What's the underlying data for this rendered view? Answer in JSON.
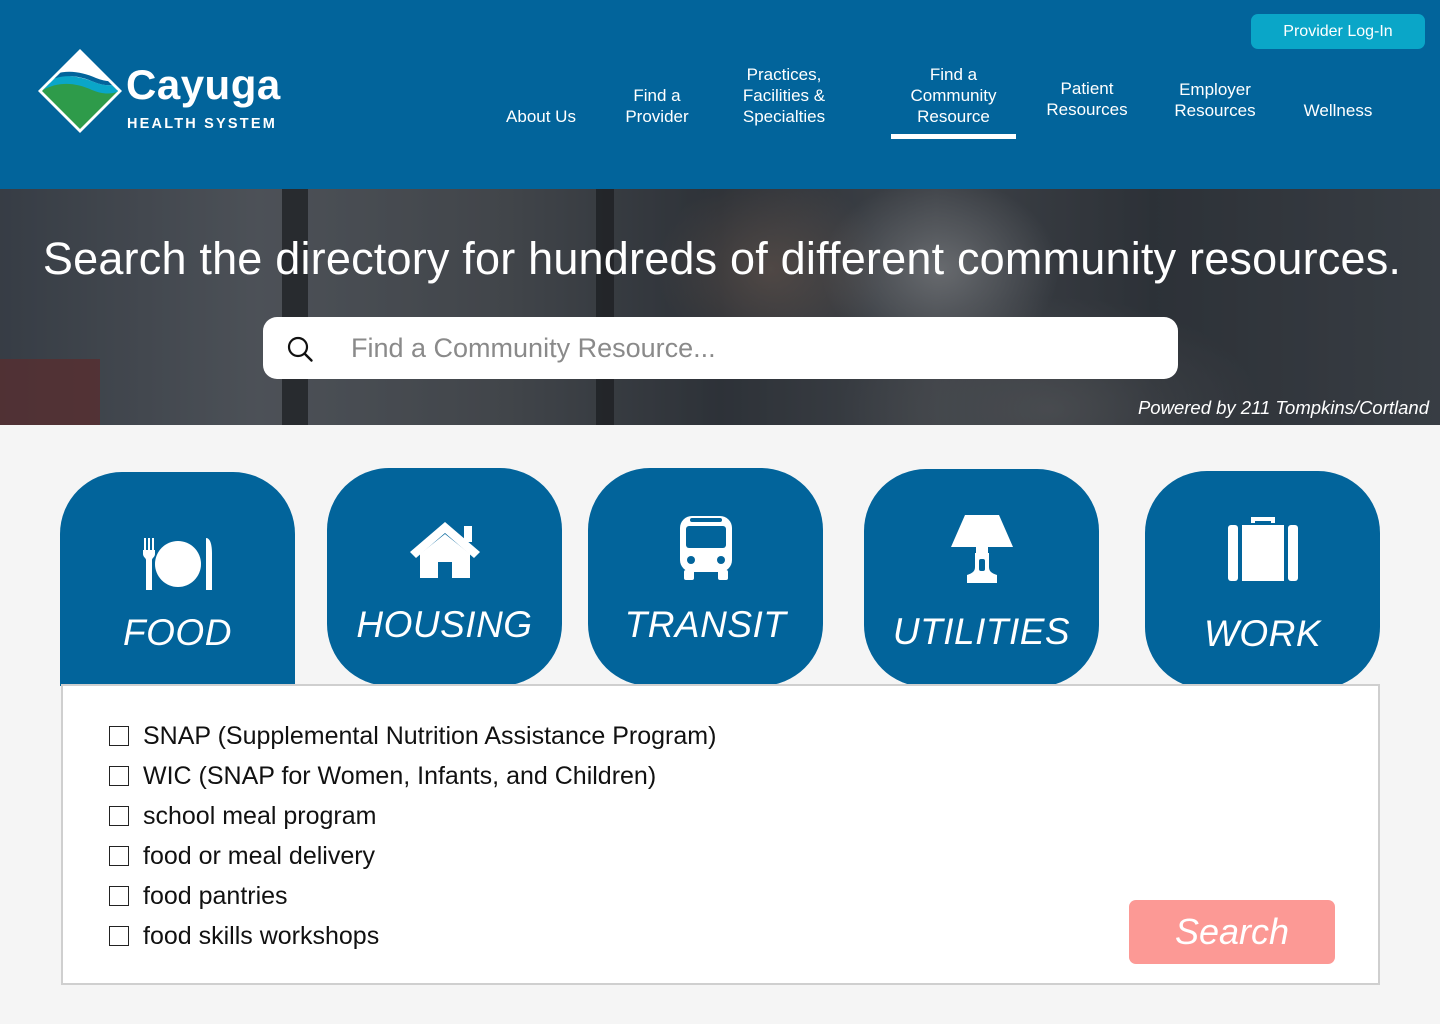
{
  "header": {
    "logo_name": "Cayuga",
    "logo_sub": "HEALTH SYSTEM",
    "login_label": "Provider Log-In",
    "nav": [
      {
        "label": "About Us"
      },
      {
        "label": "Find a\nProvider"
      },
      {
        "label": "Practices,\nFacilities &\nSpecialties"
      },
      {
        "label": "Find a\nCommunity\nResource",
        "active": true
      },
      {
        "label": "Patient\nResources"
      },
      {
        "label": "Employer\nResources"
      },
      {
        "label": "Wellness"
      }
    ]
  },
  "hero": {
    "title": "Search the directory for hundreds of different community resources.",
    "search_placeholder": "Find a Community Resource...",
    "search_value": "",
    "powered_by": "Powered by 211 Tompkins/Cortland"
  },
  "categories": [
    {
      "label": "FOOD",
      "icon": "utensils-plate-icon",
      "active": true
    },
    {
      "label": "HOUSING",
      "icon": "house-icon"
    },
    {
      "label": "TRANSIT",
      "icon": "bus-icon"
    },
    {
      "label": "UTILITIES",
      "icon": "lamp-icon"
    },
    {
      "label": "WORK",
      "icon": "briefcase-icon"
    }
  ],
  "panel": {
    "options": [
      {
        "label": "SNAP (Supplemental Nutrition Assistance Program)",
        "checked": false
      },
      {
        "label": "WIC (SNAP for Women, Infants, and Children)",
        "checked": false
      },
      {
        "label": "school meal program",
        "checked": false
      },
      {
        "label": "food or meal delivery",
        "checked": false
      },
      {
        "label": "food pantries",
        "checked": false
      },
      {
        "label": "food skills workshops",
        "checked": false
      }
    ],
    "search_label": "Search"
  },
  "colors": {
    "brand_blue": "#02649b",
    "login_teal": "#0aa6c8",
    "search_button": "#fc9995",
    "page_bg": "#f5f5f5",
    "logo_green": "#2e9b4a"
  }
}
